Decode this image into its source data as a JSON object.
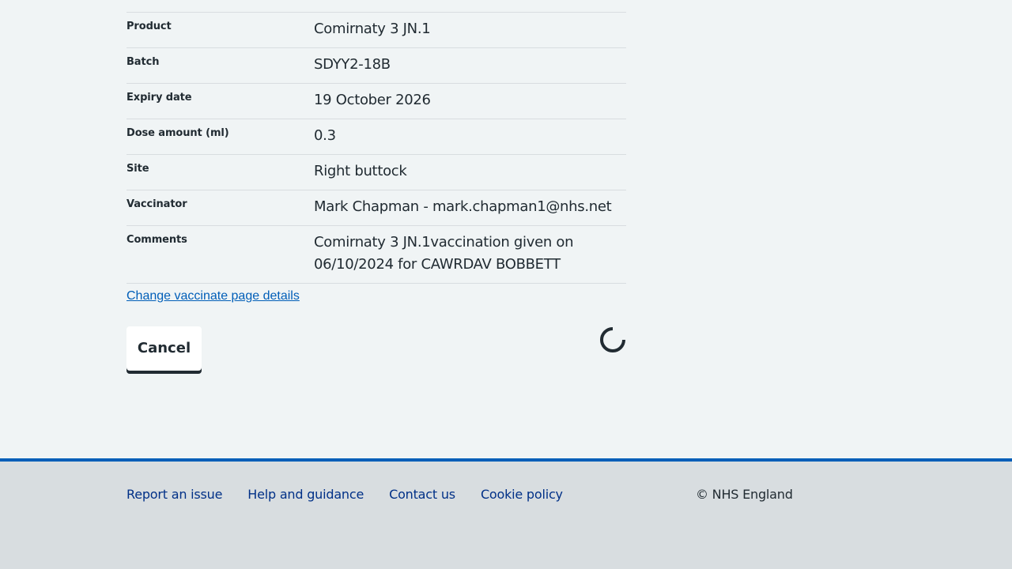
{
  "summary": {
    "rows": [
      {
        "key": "Product",
        "value": "Comirnaty 3 JN.1"
      },
      {
        "key": "Batch",
        "value": "SDYY2-18B"
      },
      {
        "key": "Expiry date",
        "value": "19 October 2026"
      },
      {
        "key": "Dose amount (ml)",
        "value": "0.3"
      },
      {
        "key": "Site",
        "value": "Right buttock"
      },
      {
        "key": "Vaccinator",
        "value": "Mark Chapman - mark.chapman1@nhs.net"
      },
      {
        "key": "Comments",
        "value": "Comirnaty 3 JN.1vaccination given on 06/10/2024 for CAWRDAV BOBBETT"
      }
    ]
  },
  "change_link": "Change vaccinate page details",
  "actions": {
    "cancel_label": "Cancel",
    "spinner_icon": "loading-spinner-icon"
  },
  "footer": {
    "links": [
      "Report an issue",
      "Help and guidance",
      "Contact us",
      "Cookie policy"
    ],
    "copyright": "© NHS England"
  },
  "colors": {
    "background": "#f0f4f5",
    "link": "#005eb8",
    "footer_link": "#003087",
    "footer_bg": "#d8dde0",
    "footer_border": "#005eb8",
    "text": "#212b32"
  }
}
